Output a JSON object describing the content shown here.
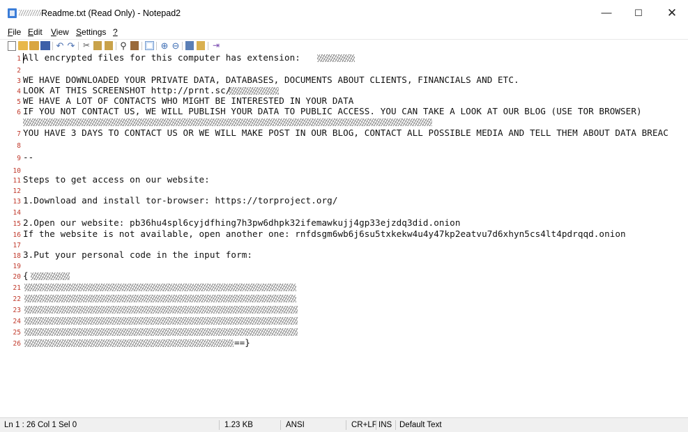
{
  "window": {
    "title": "Readme.txt (Read Only) - Notepad2",
    "minimize": "—",
    "maximize": "☐",
    "close": "✕"
  },
  "menu": [
    "File",
    "Edit",
    "View",
    "Settings",
    "?"
  ],
  "toolbar_icons": [
    "new-icon",
    "open-icon",
    "reopen-icon",
    "save-icon",
    "undo-icon",
    "redo-icon",
    "cut-icon",
    "copy-icon",
    "paste-icon",
    "find-icon",
    "replace-icon",
    "word-wrap-icon",
    "zoom-in-icon",
    "zoom-out-icon",
    "scheme-icon",
    "customize-icon",
    "exit-icon"
  ],
  "lines": [
    {
      "n": "1",
      "text": "All encrypted files for this computer has extension: "
    },
    {
      "n": "2",
      "text": ""
    },
    {
      "n": "3",
      "text": "WE HAVE DOWNLOADED YOUR PRIVATE DATA, DATABASES, DOCUMENTS ABOUT CLIENTS, FINANCIALS AND ETC."
    },
    {
      "n": "4",
      "text": "LOOK AT THIS SCREENSHOT http://prnt.sc/"
    },
    {
      "n": "5",
      "text": "WE HAVE A LOT OF CONTACTS WHO MIGHT BE INTERESTED IN YOUR DATA"
    },
    {
      "n": "6",
      "text": "IF YOU NOT CONTACT US, WE WILL PUBLISH YOUR DATA TO PUBLIC ACCESS. YOU CAN TAKE A LOOK AT OUR BLOG (USE TOR BROWSER)"
    },
    {
      "n": "",
      "text": ""
    },
    {
      "n": "7",
      "text": "YOU HAVE 3 DAYS TO CONTACT US OR WE WILL MAKE POST IN OUR BLOG, CONTACT ALL POSSIBLE MEDIA AND TELL THEM ABOUT DATA BREAC"
    },
    {
      "n": "8",
      "text": ""
    },
    {
      "n": "9",
      "text": "--"
    },
    {
      "n": "10",
      "text": ""
    },
    {
      "n": "11",
      "text": "Steps to get access on our website:"
    },
    {
      "n": "12",
      "text": ""
    },
    {
      "n": "13",
      "text": "1.Download and install tor-browser: https://torproject.org/"
    },
    {
      "n": "14",
      "text": ""
    },
    {
      "n": "15",
      "text": "2.Open our website: pb36hu4spl6cyjdfhing7h3pw6dhpk32ifemawkujj4gp33ejzdq3did.onion"
    },
    {
      "n": "16",
      "text": "If the website is not available, open another one: rnfdsgm6wb6j6su5txkekw4u4y47kp2eatvu7d6xhyn5cs4lt4pdrqqd.onion"
    },
    {
      "n": "17",
      "text": ""
    },
    {
      "n": "18",
      "text": "3.Put your personal code in the input form:"
    },
    {
      "n": "19",
      "text": ""
    },
    {
      "n": "20",
      "text": "{"
    },
    {
      "n": "21",
      "text": ""
    },
    {
      "n": "22",
      "text": ""
    },
    {
      "n": "23",
      "text": ""
    },
    {
      "n": "24",
      "text": ""
    },
    {
      "n": "25",
      "text": ""
    },
    {
      "n": "26",
      "text": "==}"
    }
  ],
  "status": {
    "position": "Ln 1 : 26  Col 1  Sel 0",
    "size": "1.23 KB",
    "encoding": "ANSI",
    "line_endings": "CR+LF",
    "mode": "INS",
    "scheme": "Default Text"
  }
}
